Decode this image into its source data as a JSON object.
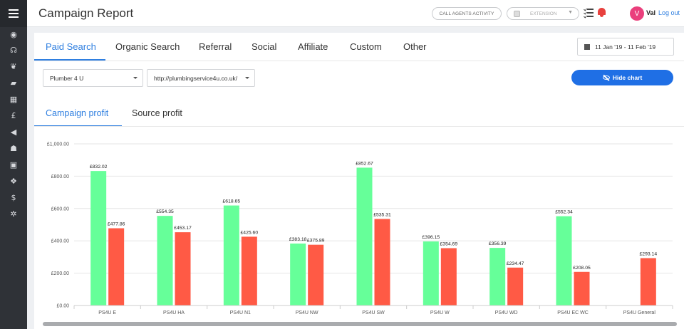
{
  "sidebar": {
    "menu_icon": "hamburger-icon",
    "items": [
      {
        "icon": "dashboard-icon",
        "glyph": "◉"
      },
      {
        "icon": "headset-icon",
        "glyph": "☊"
      },
      {
        "icon": "leaf-icon",
        "glyph": "❦"
      },
      {
        "icon": "briefcase-icon",
        "glyph": "▰"
      },
      {
        "icon": "table-icon",
        "glyph": "▦"
      },
      {
        "icon": "pound-icon",
        "glyph": "£"
      },
      {
        "icon": "megaphone-icon",
        "glyph": "◀"
      },
      {
        "icon": "users-icon",
        "glyph": "☗"
      },
      {
        "icon": "contact-book-icon",
        "glyph": "▣"
      },
      {
        "icon": "cubes-icon",
        "glyph": "❖"
      },
      {
        "icon": "dollar-icon",
        "glyph": "$"
      },
      {
        "icon": "settings-icon",
        "glyph": "✲"
      }
    ]
  },
  "header": {
    "title": "Campaign Report",
    "call_agents_label": "CALL AGENTS ACTIVITY",
    "extension_placeholder": "EXTENSION",
    "avatar_initial": "V",
    "user_name": "Val",
    "logout_label": "Log out"
  },
  "tabs": {
    "items": [
      "Paid Search",
      "Organic Search",
      "Referral",
      "Social",
      "Affiliate",
      "Custom",
      "Other"
    ],
    "active": 0
  },
  "date_range": "11 Jan '19 - 11 Feb '19",
  "filters": {
    "client": "Plumber 4 U",
    "website": "http://plumbingservice4u.co.uk/"
  },
  "hide_chart_label": "Hide chart",
  "subtabs": {
    "items": [
      "Campaign profit",
      "Source profit"
    ],
    "active": 0
  },
  "colors": {
    "accent": "#2f7fe0",
    "button": "#1f6fe5",
    "series_green": "#66ff99",
    "series_red": "#ff5a45"
  },
  "chart_data": {
    "type": "bar",
    "categories": [
      "PS4U E",
      "PS4U HA",
      "PS4U N1",
      "PS4U NW",
      "PS4U SW",
      "PS4U W",
      "PS4U WD",
      "PS4U EC WC",
      "PS4U General"
    ],
    "series": [
      {
        "values": [
          832.02,
          554.35,
          618.65,
          383.18,
          852.67,
          396.15,
          356.39,
          552.34,
          null
        ],
        "labels": [
          "£832.02",
          "£554.35",
          "£618.65",
          "£383.18",
          "£852.67",
          "£396.15",
          "£356.39",
          "£552.34",
          ""
        ],
        "color": "#66ff99"
      },
      {
        "values": [
          477.86,
          453.17,
          425.6,
          375.89,
          535.31,
          354.69,
          234.47,
          208.05,
          293.14
        ],
        "labels": [
          "£477.86",
          "£453.17",
          "£425.60",
          "£375.89",
          "£535.31",
          "£354.69",
          "£234.47",
          "£208.05",
          "£293.14"
        ],
        "color": "#ff5a45"
      }
    ],
    "ylim": [
      0,
      1000
    ],
    "yticks": [
      0,
      200,
      400,
      600,
      800,
      1000
    ],
    "ytick_labels": [
      "£0.00",
      "£200.00",
      "£400.00",
      "£600.00",
      "£800.00",
      "£1,000.00"
    ],
    "grid": true,
    "legend": "none"
  }
}
